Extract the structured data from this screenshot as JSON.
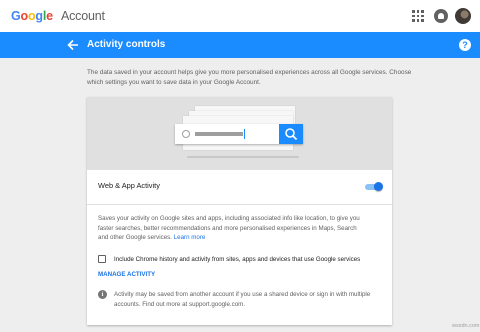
{
  "topbar": {
    "logo": {
      "letters": [
        "G",
        "o",
        "o",
        "g",
        "l",
        "e"
      ],
      "letter_colors": [
        "#4285f4",
        "#ea4335",
        "#fbbc05",
        "#4285f4",
        "#34a853",
        "#ea4335"
      ],
      "product": "Account"
    },
    "icons": [
      "apps-icon",
      "notifications-icon",
      "avatar"
    ]
  },
  "header": {
    "title": "Activity controls",
    "back_icon": "arrow-left-icon",
    "help_icon": "?",
    "color": "#1a8cff"
  },
  "intro": "The data saved in your account helps give you more personalised experiences across all Google services. Choose which settings you want to save data in your Google Account.",
  "card": {
    "section_title": "Web & App Activity",
    "toggle_on": true,
    "description": "Saves your activity on Google sites and apps, including associated info like location, to give you faster searches, better recommendations and more personalised experiences in Maps, Search and other Google services.",
    "learn_more": "Learn more",
    "checkbox_checked": false,
    "checkbox_label": "Include Chrome history and activity from sites, apps and devices that use Google services",
    "manage_label": "MANAGE ACTIVITY",
    "info_icon": "i",
    "note": "Activity may be saved from another account if you use a shared device or sign in with multiple accounts. Find out more at support.google.com."
  },
  "watermark": "wsxdn.com",
  "colors": {
    "accent": "#1a73e8",
    "header": "#1a8cff",
    "background": "#eeeeee"
  }
}
